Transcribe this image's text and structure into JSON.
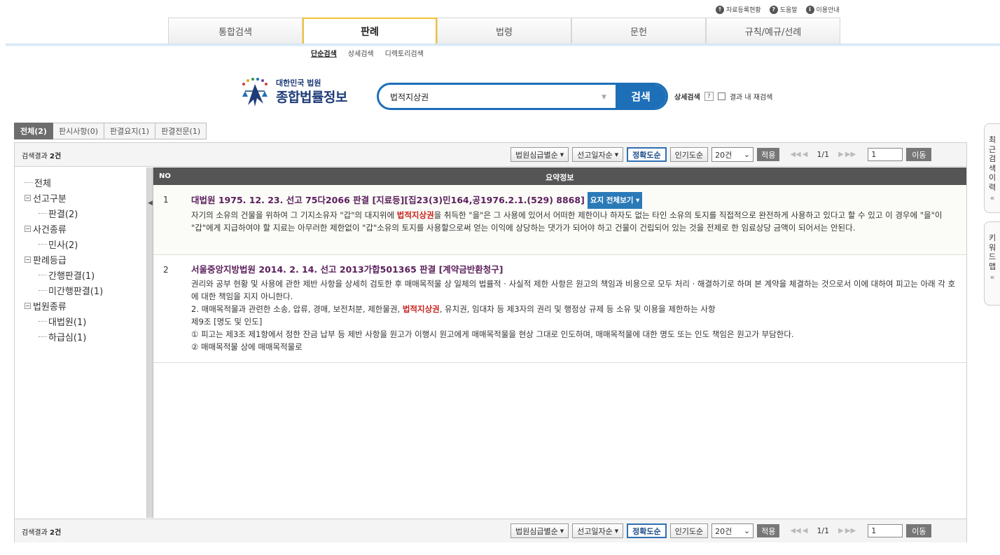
{
  "util_links": [
    {
      "icon": "arrow-up-icon",
      "glyph": "↑",
      "label": "자료등록현황"
    },
    {
      "icon": "help-icon",
      "glyph": "?",
      "label": "도움말"
    },
    {
      "icon": "info-icon",
      "glyph": "i",
      "label": "이용안내"
    }
  ],
  "main_tabs": [
    "통합검색",
    "판례",
    "법령",
    "문헌",
    "규칙/예규/선례"
  ],
  "sub_tabs": [
    "단순검색",
    "상세검색",
    "디렉토리검색"
  ],
  "logo": {
    "sub": "대한민국 법원",
    "main": "종합법률정보"
  },
  "search": {
    "value": "법적지상권",
    "button": "검색",
    "advanced": "상세검색",
    "help": "?",
    "within": "결과 내 재검색"
  },
  "result_tabs": [
    "전체(2)",
    "판시사항(0)",
    "판결요지(1)",
    "판결전문(1)"
  ],
  "toolbar": {
    "count_prefix": "검색결과 ",
    "count_value": "2건",
    "sort_court": "법원심급별순",
    "sort_date": "선고일자순",
    "sort_accuracy": "정확도순",
    "sort_popular": "인기도순",
    "page_size": "20건",
    "apply": "적용",
    "page_info": "1/1",
    "page_input": "1",
    "go": "이동"
  },
  "tree": [
    {
      "label": "전체",
      "level": 0,
      "expander": false
    },
    {
      "label": "선고구분",
      "level": 0,
      "expander": true
    },
    {
      "label": "판결(2)",
      "level": 1,
      "expander": false
    },
    {
      "label": "사건종류",
      "level": 0,
      "expander": true
    },
    {
      "label": "민사(2)",
      "level": 1,
      "expander": false
    },
    {
      "label": "판례등급",
      "level": 0,
      "expander": true
    },
    {
      "label": "간행판결(1)",
      "level": 1,
      "expander": false
    },
    {
      "label": "미간행판결(1)",
      "level": 1,
      "expander": false
    },
    {
      "label": "법원종류",
      "level": 0,
      "expander": true
    },
    {
      "label": "대법원(1)",
      "level": 1,
      "expander": false
    },
    {
      "label": "하급심(1)",
      "level": 1,
      "expander": false
    }
  ],
  "table_head": {
    "no": "NO",
    "summary": "요약정보"
  },
  "results": [
    {
      "no": "1",
      "title": "대법원 1975. 12. 23. 선고 75다2066 판결 [지료등][집23(3)민164,공1976.2.1.(529) 8868]",
      "button": "요지 전체보기",
      "body_pre": "자기의 소유의 건물을 위하여 그 기지소유자 \"갑\"의 대지위에 ",
      "body_hl": "법적지상권",
      "body_post": "을 취득한 \"을\"은 그 사용에 있어서 어떠한 제한이나 하자도 없는 타인 소유의 토지를 직접적으로 완전하게 사용하고 있다고 할 수 있고 이 경우에 \"을\"이 \"갑\"에게 지급하여야 할 지료는 아무러한 제한없이 \"갑\"소유의 토지를 사용할으로써 얻는 이익에 상당하는 댓가가 되어야 하고 건물이 건립되어 있는 것을 전제로 한 임료상당 금액이 되어서는 안된다."
    },
    {
      "no": "2",
      "title": "서울중앙지방법원 2014. 2. 14. 선고 2013가합501365 판결 [계약금반환청구]",
      "line1": "권리와 공부 현황 및 사용에 관한 제반 사항을 상세히 검토한 후 매매목적물 상 일체의 법률적 · 사실적 제한 사항은 원고의 책임과 비용으로 모두 처리 · 해결하기로 하며 본 계약을 체결하는 것으로서 이에 대하여 피고는 아래 각 호에 대한 책임을 지지 아니한다.",
      "line2_pre": "2. 매매목적물과 관련한 소송, 압류, 경매, 보전처분, 제한물권, ",
      "line2_hl": "법적지상권",
      "line2_post": ", 유치권, 임대차 등 제3자의 권리 및 행정상 규제 등 소유 및 이용을 제한하는 사항",
      "line3": "제9조 [명도 및 인도]",
      "line4": "① 피고는 제3조 제1항에서 정한 잔금 납부 등 제반 사항을 원고가 이행시 원고에게 매매목적물을 현상 그대로 인도하며, 매매목적물에 대한 명도 또는 인도 책임은 원고가 부담한다.",
      "line5": "② 매매목적물 상에 매매목적물로"
    }
  ],
  "side_tabs": [
    {
      "label": "최근검색이력",
      "arrow": "«"
    },
    {
      "label": "키워드맵",
      "arrow": "«"
    }
  ],
  "colors": {
    "primary": "#1d6fb8",
    "highlight": "#c8231e",
    "title": "#5a1f5c",
    "active_tab_border": "#f2c12e"
  }
}
